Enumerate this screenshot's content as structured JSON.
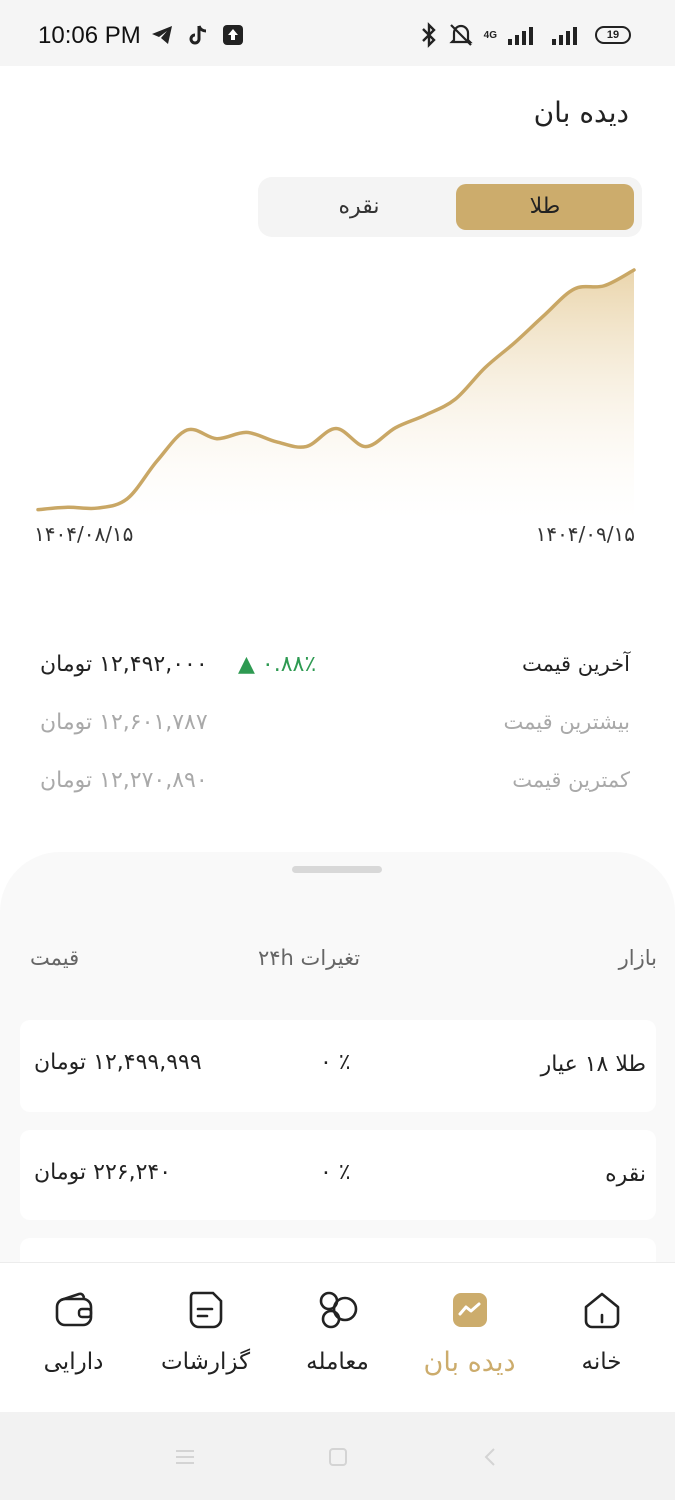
{
  "status_bar": {
    "time": "10:06 PM",
    "network": "4G",
    "battery": "19"
  },
  "header": {
    "title": "دیده بان"
  },
  "segment": {
    "gold_label": "طلا",
    "silver_label": "نقره",
    "selected": "gold"
  },
  "chart_data": {
    "type": "area",
    "x_start_label": "۱۴۰۴/۰۸/۱۵",
    "x_end_label": "۱۴۰۴/۰۹/۱۵",
    "values": [
      0.98,
      1.01,
      1.0,
      1.12,
      1.6,
      1.99,
      1.88,
      1.96,
      1.84,
      1.78,
      2.01,
      1.78,
      2.02,
      2.18,
      2.38,
      2.78,
      3.1,
      3.45,
      3.78,
      3.82,
      4.02
    ],
    "line_color": "#c9a765",
    "fill_color": "#e9d3a8",
    "grid": false
  },
  "prices": {
    "last_label": "آخرین قیمت",
    "last_value": "۱۲,۴۹۲,۰۰۰ تومان",
    "last_change": "▲ ۰.۸۸٪",
    "change_color": "#2e9a52",
    "high_label": "بیشترین قیمت",
    "high_value": "۱۲,۶۰۱,۷۸۷ تومان",
    "low_label": "کمترین قیمت",
    "low_value": "۱۲,۲۷۰,۸۹۰ تومان"
  },
  "market": {
    "col_market": "بازار",
    "col_change": "تغیرات ۲۴h",
    "col_price": "قیمت",
    "rows": [
      {
        "name": "طلا ۱۸ عیار",
        "change": "۰ ٪",
        "price": "۱۲,۴۹۹,۹۹۹ تومان"
      },
      {
        "name": "نقره",
        "change": "۰ ٪",
        "price": "۲۲۶,۲۴۰ تومان"
      }
    ]
  },
  "bottom_nav": {
    "items": [
      {
        "label": "خانه",
        "icon": "home-icon"
      },
      {
        "label": "دیده بان",
        "icon": "watchlist-icon"
      },
      {
        "label": "معامله",
        "icon": "trade-icon"
      },
      {
        "label": "گزارشات",
        "icon": "reports-icon"
      },
      {
        "label": "دارایی",
        "icon": "wallet-icon"
      }
    ],
    "active_index": 1,
    "active_color": "#ccac6c"
  }
}
